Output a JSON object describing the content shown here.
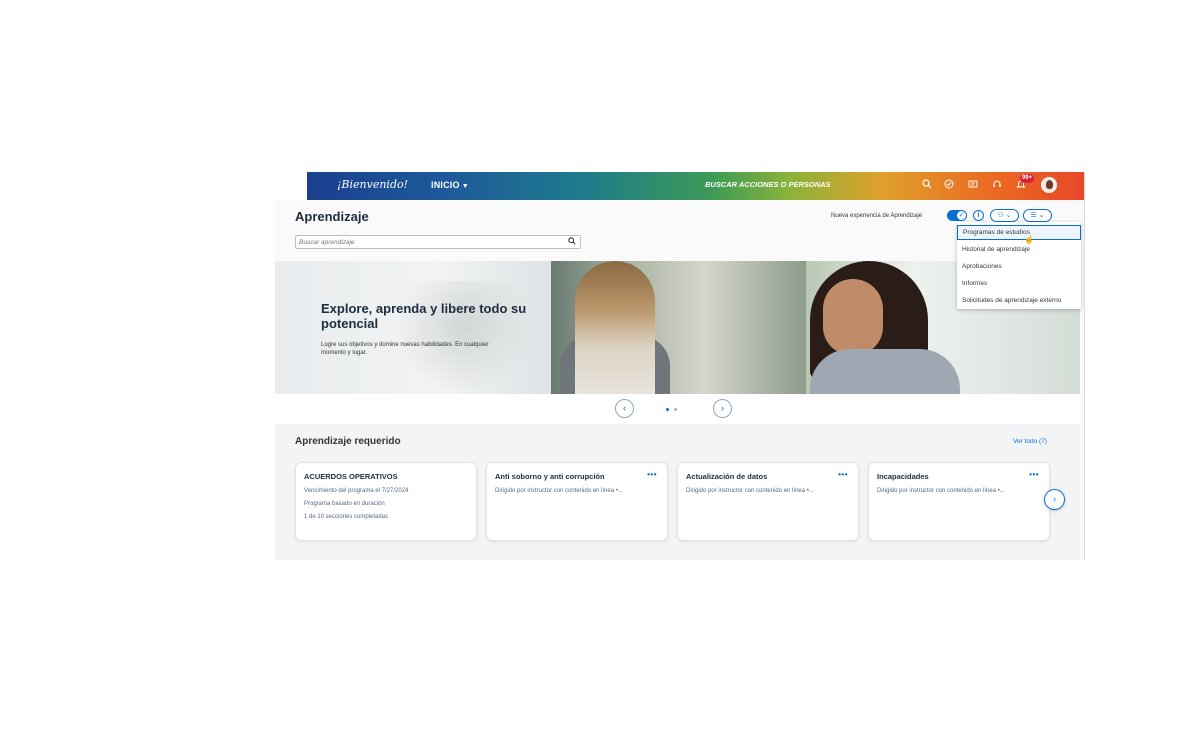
{
  "topbar": {
    "logo_text": "¡Bienvenido!",
    "home_label": "INICIO",
    "search_label": "BUSCAR ACCIONES O PERSONAS",
    "notification_count": "99+",
    "icons": [
      "search-icon",
      "check-circle-icon",
      "inbox-icon",
      "headset-icon",
      "bell-icon",
      "avatar"
    ]
  },
  "page": {
    "title": "Aprendizaje",
    "search_placeholder": "Buscar aprendizaje",
    "new_experience_label": "Nueva experiencia de Aprendizaje",
    "toggle_on": true
  },
  "dropdown": {
    "items": [
      {
        "label": "Programas de estudios"
      },
      {
        "label": "Historial de aprendizaje"
      },
      {
        "label": "Aprobaciones"
      },
      {
        "label": "Informes"
      },
      {
        "label": "Solicitudes de aprendizaje externo"
      }
    ]
  },
  "hero": {
    "title": "Explore, aprenda y libere todo su potencial",
    "subtitle": "Logre sus objetivos y domine nuevas habilidades. En cualquier momento y lugar."
  },
  "required": {
    "title": "Aprendizaje requerido",
    "view_all": "Ver todo (7)",
    "cards": [
      {
        "title": "ACUERDOS OPERATIVOS",
        "lines": [
          "Vencimiento del programa el 7/27/2024",
          "Programa basado en duración",
          "1 de 10 secciones completadas"
        ]
      },
      {
        "title": "Anti soborno y anti corrupción",
        "more": "•••",
        "lines": [
          "Dirigido por instructor con contenido en línea •..."
        ]
      },
      {
        "title": "Actualización de datos",
        "more": "•••",
        "lines": [
          "Dirigido por instructor con contenido en línea •..."
        ]
      },
      {
        "title": "Incapacidades",
        "more": "•••",
        "lines": [
          "Dirigido por instructor con contenido en línea •..."
        ]
      }
    ]
  },
  "colors": {
    "accent": "#0a6ed1",
    "title_text": "#1d2d3e",
    "badge": "#d8203a"
  }
}
